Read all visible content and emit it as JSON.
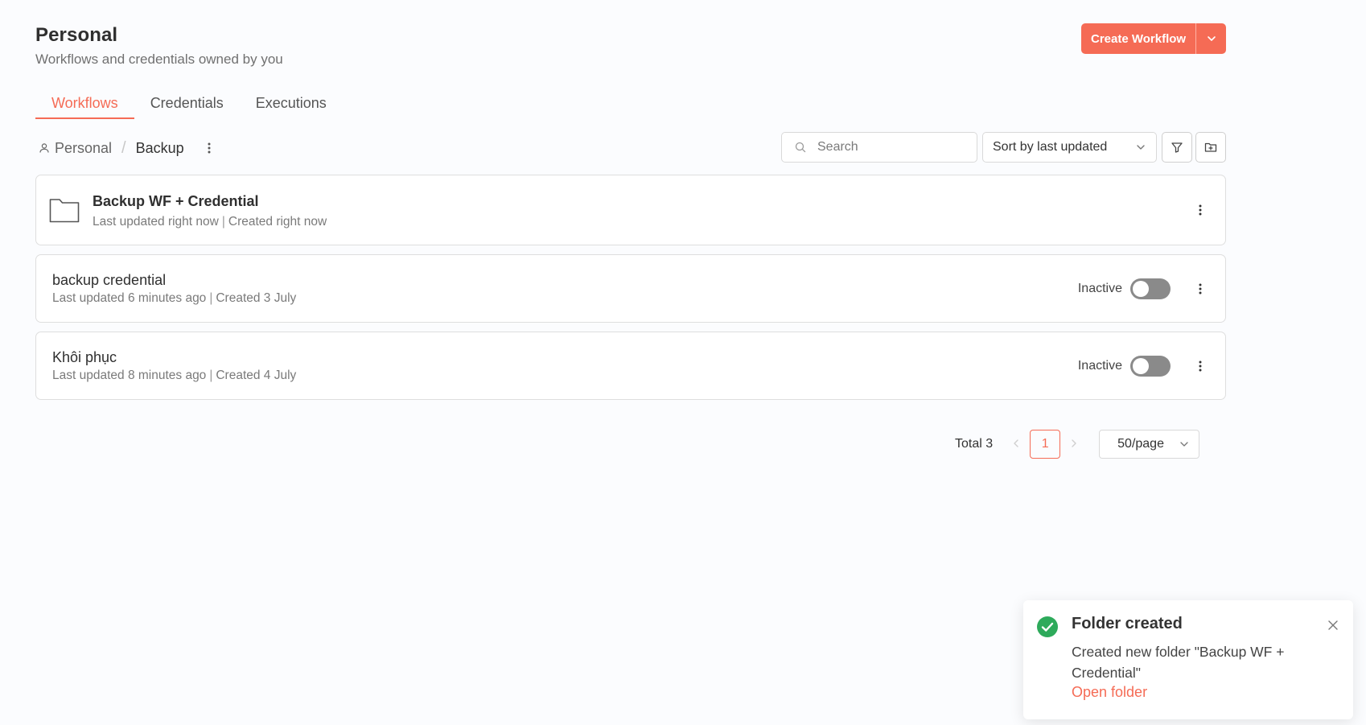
{
  "header": {
    "title": "Personal",
    "subtitle": "Workflows and credentials owned by you",
    "create_label": "Create Workflow"
  },
  "tabs": [
    {
      "label": "Workflows",
      "active": true
    },
    {
      "label": "Credentials",
      "active": false
    },
    {
      "label": "Executions",
      "active": false
    }
  ],
  "breadcrumb": {
    "root": "Personal",
    "separator": "/",
    "current": "Backup"
  },
  "toolbar": {
    "search_placeholder": "Search",
    "sort_label": "Sort by last updated"
  },
  "items": [
    {
      "type": "folder",
      "title": "Backup WF + Credential",
      "updated": "Last updated right now",
      "created": "Created right now"
    },
    {
      "type": "workflow",
      "title": "backup credential",
      "updated": "Last updated 6 minutes ago",
      "created": "Created 3 July",
      "status": "Inactive",
      "active": false
    },
    {
      "type": "workflow",
      "title": "Khôi phục",
      "updated": "Last updated 8 minutes ago",
      "created": "Created 4 July",
      "status": "Inactive",
      "active": false
    }
  ],
  "pagination": {
    "total": "Total 3",
    "current_page": "1",
    "per_page": "50/page"
  },
  "toast": {
    "title": "Folder created",
    "message": "Created new folder \"Backup WF + Credential\"",
    "link": "Open folder"
  },
  "colors": {
    "accent": "#f56b55",
    "success": "#2eaa5b",
    "toggle_off": "#8a8a8a"
  }
}
